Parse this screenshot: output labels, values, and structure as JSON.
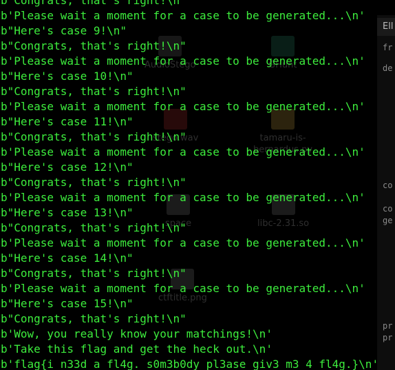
{
  "colors": {
    "background": "#000000",
    "terminal_text": "#3ded3d"
  },
  "desktop": {
    "icons": [
      {
        "name": "audio-file-icon",
        "label": "AudioStego",
        "color": "#6a6a6a"
      },
      {
        "name": "audio-file-icon",
        "label": "stego.wav",
        "color": "#b03030"
      },
      {
        "name": "python-file-icon",
        "label": "tamaru-is-",
        "color": "#c8a040"
      },
      {
        "name": "python-file-icon",
        "label": "bernardus.py",
        "color": "#c8a040"
      },
      {
        "name": "library-file-icon",
        "label": "libc-2.31.so",
        "color": "#7a7a7a"
      },
      {
        "name": "folder-icon",
        "label": "space",
        "color": "#7a7a7a"
      },
      {
        "name": "image-file-icon",
        "label": "ctftitle.png",
        "color": "#7a7a7a"
      },
      {
        "name": "app-icon",
        "label": "GHunt",
        "color": "#2a8a6a"
      }
    ]
  },
  "side_panel": {
    "tab_label": "Ell",
    "snippets": [
      "fr",
      "de",
      "co",
      "co",
      "ge",
      "pr",
      "pr"
    ]
  },
  "terminal": {
    "lines": [
      "b\"Congrats, that's right!\\n\"",
      "b'Please wait a moment for a case to be generated...\\n'",
      "b\"Here's case 9!\\n\"",
      "b\"Congrats, that's right!\\n\"",
      "b'Please wait a moment for a case to be generated...\\n'",
      "b\"Here's case 10!\\n\"",
      "b\"Congrats, that's right!\\n\"",
      "b'Please wait a moment for a case to be generated...\\n'",
      "b\"Here's case 11!\\n\"",
      "b\"Congrats, that's right!\\n\"",
      "b'Please wait a moment for a case to be generated...\\n'",
      "b\"Here's case 12!\\n\"",
      "b\"Congrats, that's right!\\n\"",
      "b'Please wait a moment for a case to be generated...\\n'",
      "b\"Here's case 13!\\n\"",
      "b\"Congrats, that's right!\\n\"",
      "b'Please wait a moment for a case to be generated...\\n'",
      "b\"Here's case 14!\\n\"",
      "b\"Congrats, that's right!\\n\"",
      "b'Please wait a moment for a case to be generated...\\n'",
      "b\"Here's case 15!\\n\"",
      "b\"Congrats, that's right!\\n\"",
      "b'Wow, you really know your matchings!\\n'",
      "b'Take this flag and get the heck out.\\n'",
      "b'flag{i_n33d_a_fl4g._s0m3b0dy_pl3ase_giv3_m3_4_fl4g.}\\n'"
    ]
  }
}
